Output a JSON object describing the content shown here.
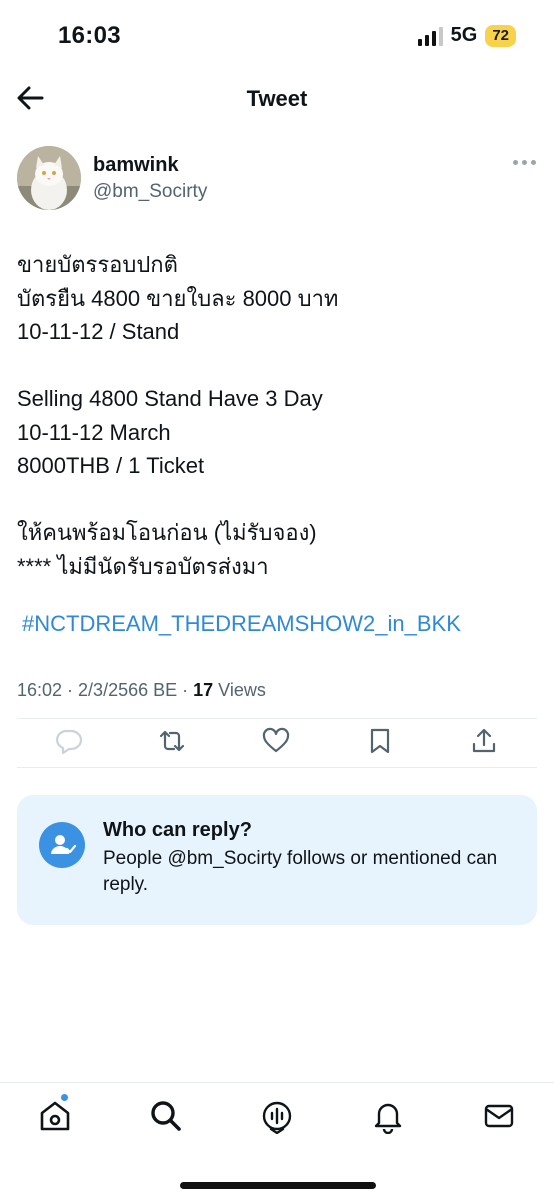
{
  "status_bar": {
    "time": "16:03",
    "network": "5G",
    "battery": "72"
  },
  "header": {
    "title": "Tweet"
  },
  "author": {
    "name": "bamwink",
    "handle": "@bm_Socirty"
  },
  "tweet": {
    "lines": [
      "ขายบัตรรอบปกติ",
      "บัตรยืน 4800 ขายใบละ 8000 บาท",
      "10-11-12 / Stand",
      "",
      "Selling 4800 Stand Have 3 Day",
      "10-11-12 March",
      "8000THB / 1 Ticket",
      "",
      "ให้คนพร้อมโอนก่อน (ไม่รับจอง)",
      "**** ไม่มีนัดรับรอบัตรส่งมา"
    ],
    "hashtag": "#NCTDREAM_THEDREAMSHOW2_in_BKK",
    "timestamp": "16:02 · 2/3/2566 BE · ",
    "views_count": "17",
    "views_label": " Views"
  },
  "reply_restriction": {
    "title": "Who can reply?",
    "text": "People @bm_Socirty follows or mentioned can reply."
  },
  "icons": {
    "back": "arrow-left-icon",
    "more": "more-horizontal-icon",
    "reply": "reply-icon",
    "retweet": "retweet-icon",
    "like": "heart-icon",
    "bookmark": "bookmark-icon",
    "share": "share-icon",
    "home": "home-icon",
    "search": "search-icon",
    "spaces": "spaces-icon",
    "notifications": "bell-icon",
    "messages": "mail-icon"
  },
  "colors": {
    "accent": "#1d9bf0",
    "link": "#2f89d8",
    "card_bg": "#e8f4fd",
    "battery": "#f7d24a"
  }
}
